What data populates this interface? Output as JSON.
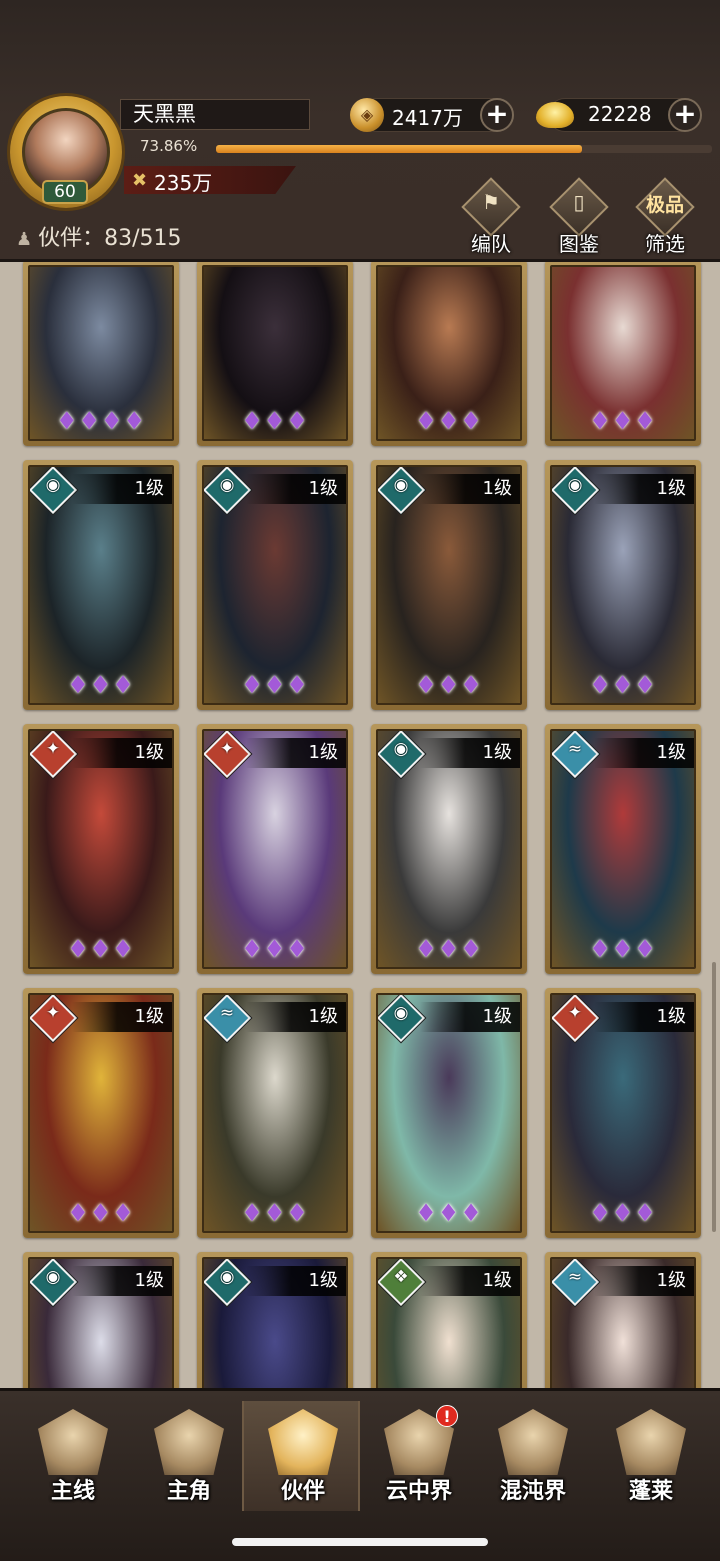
{
  "player": {
    "name": "天黑黑",
    "level": "60",
    "exp_percent_label": "73.86%",
    "exp_fraction": 0.7386,
    "power": "235万"
  },
  "currency": {
    "coins": "2417万",
    "gold": "22228"
  },
  "partners": {
    "label": "伙伴：83/515"
  },
  "tools": [
    {
      "label": "编队",
      "icon": "flag-icon"
    },
    {
      "label": "图鉴",
      "icon": "scroll-icon"
    },
    {
      "label": "筛选",
      "badge": "极品",
      "icon": "filter-icon"
    }
  ],
  "cards": [
    {
      "level": "",
      "element": "",
      "stars": 4
    },
    {
      "level": "",
      "element": "",
      "stars": 3
    },
    {
      "level": "",
      "element": "",
      "stars": 3
    },
    {
      "level": "",
      "element": "",
      "stars": 3
    },
    {
      "level": "1级",
      "element": "dark",
      "stars": 3
    },
    {
      "level": "1级",
      "element": "dark",
      "stars": 3
    },
    {
      "level": "1级",
      "element": "dark",
      "stars": 3
    },
    {
      "level": "1级",
      "element": "dark",
      "stars": 3
    },
    {
      "level": "1级",
      "element": "fire",
      "stars": 3
    },
    {
      "level": "1级",
      "element": "fire",
      "stars": 3
    },
    {
      "level": "1级",
      "element": "dark",
      "stars": 3
    },
    {
      "level": "1级",
      "element": "water",
      "stars": 3
    },
    {
      "level": "1级",
      "element": "fire",
      "stars": 3
    },
    {
      "level": "1级",
      "element": "water",
      "stars": 3
    },
    {
      "level": "1级",
      "element": "dark",
      "stars": 3
    },
    {
      "level": "1级",
      "element": "fire",
      "stars": 3
    },
    {
      "level": "1级",
      "element": "dark",
      "stars": 0
    },
    {
      "level": "1级",
      "element": "dark",
      "stars": 0
    },
    {
      "level": "1级",
      "element": "wind",
      "stars": 0
    },
    {
      "level": "1级",
      "element": "water",
      "stars": 0
    }
  ],
  "nav": [
    {
      "label": "主线",
      "icon": "crossed-swords-icon"
    },
    {
      "label": "主角",
      "icon": "hero-icon"
    },
    {
      "label": "伙伴",
      "icon": "partner-icon",
      "active": true
    },
    {
      "label": "云中界",
      "icon": "temple-icon",
      "alert": "!"
    },
    {
      "label": "混沌界",
      "icon": "tower-icon"
    },
    {
      "label": "蓬莱",
      "icon": "immortal-icon"
    }
  ],
  "colors": {
    "dark": "#1f6a6a",
    "fire": "#b8402e",
    "water": "#3a8fa8",
    "wind": "#4f7f3a",
    "star": "#a35ad8"
  }
}
